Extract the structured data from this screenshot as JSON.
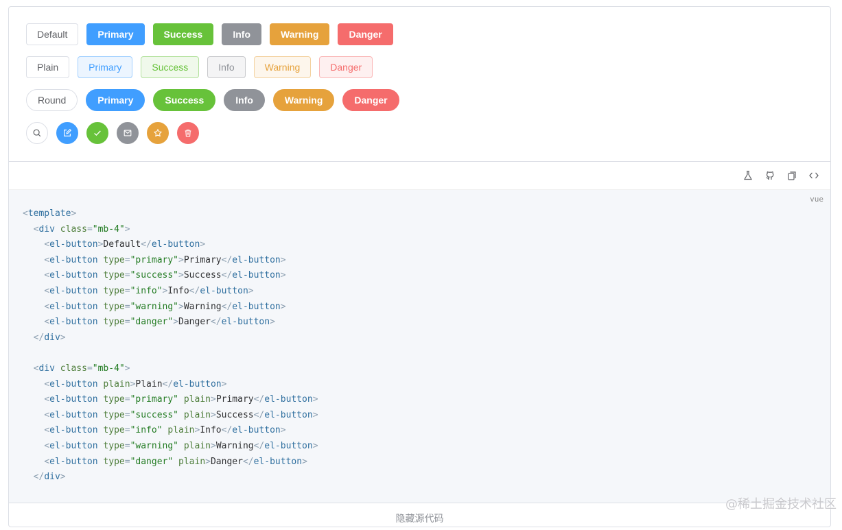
{
  "rows": {
    "basic": [
      "Default",
      "Primary",
      "Success",
      "Info",
      "Warning",
      "Danger"
    ],
    "plain": [
      "Plain",
      "Primary",
      "Success",
      "Info",
      "Warning",
      "Danger"
    ],
    "round": [
      "Round",
      "Primary",
      "Success",
      "Info",
      "Warning",
      "Danger"
    ]
  },
  "circle_icons": [
    "search-icon",
    "edit-icon",
    "check-icon",
    "message-icon",
    "star-icon",
    "delete-icon"
  ],
  "toolbar_icons": [
    "playground-icon",
    "github-icon",
    "copy-icon",
    "code-icon"
  ],
  "code": {
    "lang": "vue",
    "lines": [
      "<template>",
      "  <div class=\"mb-4\">",
      "    <el-button>Default</el-button>",
      "    <el-button type=\"primary\">Primary</el-button>",
      "    <el-button type=\"success\">Success</el-button>",
      "    <el-button type=\"info\">Info</el-button>",
      "    <el-button type=\"warning\">Warning</el-button>",
      "    <el-button type=\"danger\">Danger</el-button>",
      "  </div>",
      "",
      "  <div class=\"mb-4\">",
      "    <el-button plain>Plain</el-button>",
      "    <el-button type=\"primary\" plain>Primary</el-button>",
      "    <el-button type=\"success\" plain>Success</el-button>",
      "    <el-button type=\"info\" plain>Info</el-button>",
      "    <el-button type=\"warning\" plain>Warning</el-button>",
      "    <el-button type=\"danger\" plain>Danger</el-button>",
      "  </div>"
    ]
  },
  "footer_text": "隐藏源代码",
  "watermark": "@稀土掘金技术社区",
  "colors": {
    "primary": "#409eff",
    "success": "#67c23a",
    "info": "#909399",
    "warning": "#e6a23c",
    "danger": "#f56c6c"
  }
}
